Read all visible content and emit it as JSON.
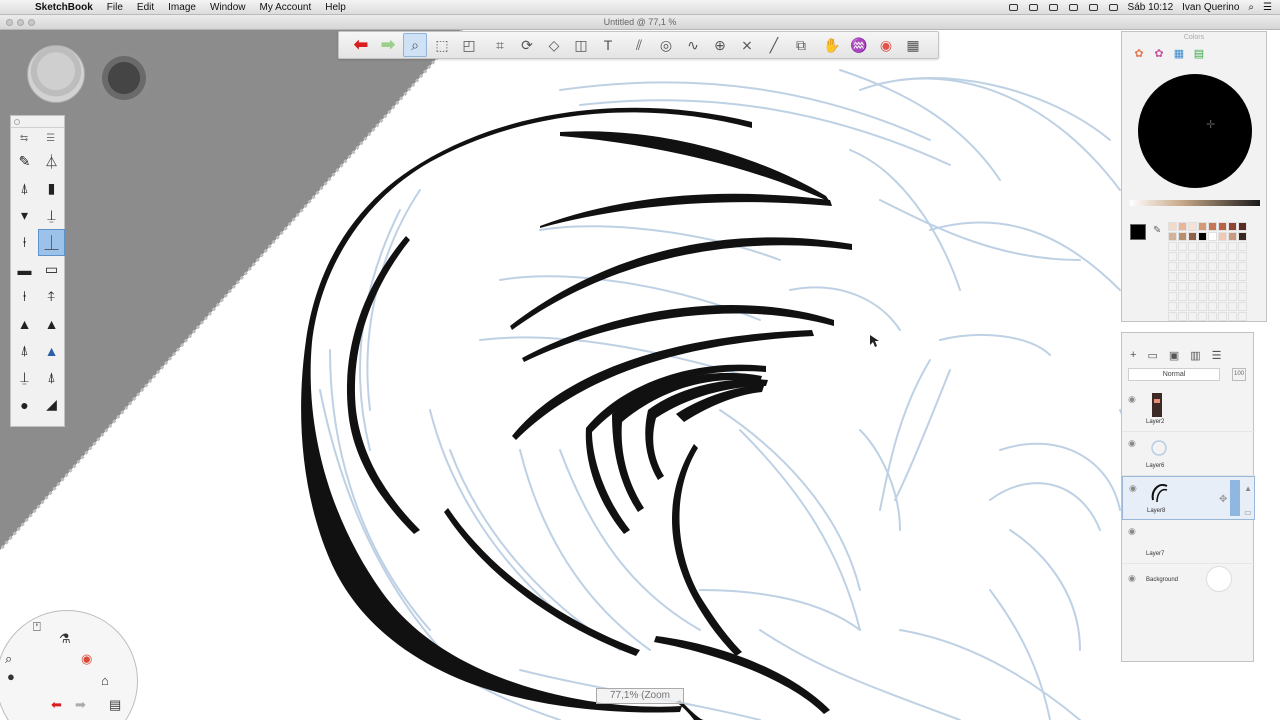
{
  "menubar": {
    "apple_icon": "apple-icon",
    "app_name": "SketchBook",
    "menus": [
      "File",
      "Edit",
      "Image",
      "Window",
      "My Account",
      "Help"
    ],
    "clock": "Sáb 10:12",
    "user": "Ivan Querino"
  },
  "window": {
    "title": "Untitled @ 77,1 %"
  },
  "toolbar": {
    "tools": [
      {
        "name": "undo",
        "glyph": "⬅"
      },
      {
        "name": "redo",
        "glyph": "➡"
      },
      {
        "name": "zoom",
        "glyph": "🔍"
      },
      {
        "name": "select",
        "glyph": "⬚"
      },
      {
        "name": "lasso-select",
        "glyph": "⬚"
      },
      {
        "name": "crop",
        "glyph": "⌗"
      },
      {
        "name": "rotate",
        "glyph": "⟳"
      },
      {
        "name": "transform",
        "glyph": "◇"
      },
      {
        "name": "shape",
        "glyph": "◫"
      },
      {
        "name": "text",
        "glyph": "T"
      },
      {
        "name": "ruler",
        "glyph": "📏"
      },
      {
        "name": "ellipse",
        "glyph": "◎"
      },
      {
        "name": "french-curve",
        "glyph": "∿"
      },
      {
        "name": "perspective",
        "glyph": "⊕"
      },
      {
        "name": "symmetry",
        "glyph": "⨯"
      },
      {
        "name": "line",
        "glyph": "╱"
      },
      {
        "name": "copy-paste",
        "glyph": "⧉"
      },
      {
        "name": "brush-palette",
        "glyph": "✋"
      },
      {
        "name": "brush-properties",
        "glyph": "♒"
      },
      {
        "name": "color-editor",
        "glyph": "◉"
      },
      {
        "name": "layer-editor",
        "glyph": "▦"
      }
    ],
    "active_tool": "zoom"
  },
  "brush_palette": {
    "brushes": [
      "pencil-brush",
      "technical-pen-brush",
      "airbrush",
      "marker-brush",
      "ballpoint-brush",
      "felt-pen-brush",
      "ink-pen-brush",
      "chisel-brush",
      "fill-brush",
      "eraser-brush",
      "smear-brush",
      "blur-brush",
      "sharpen-brush",
      "dodge-brush",
      "burn-brush",
      "flood-brush",
      "paint-brush",
      "textured-brush",
      "stamp-brush",
      "hard-eraser-brush"
    ],
    "active_index": 7
  },
  "zoom_indicator": "77,1% (Zoom",
  "colors_panel": {
    "title": "Colors",
    "current_color": "#000000",
    "swatches": [
      "#f4d9c6",
      "#e9b699",
      "#f7e3d3",
      "#d49a78",
      "#c47753",
      "#b96445",
      "#8f4533",
      "#5a2b22",
      "#d3b49b",
      "#b98e6f",
      "#8e6249",
      "#000000",
      "#ffffff",
      "#f0c8b4",
      "#c99a80",
      "#3a2620"
    ]
  },
  "layers_panel": {
    "blend_mode": "Normal",
    "opacity": "100",
    "layers": [
      {
        "name": "Layer2",
        "active": false
      },
      {
        "name": "Layer6",
        "active": false
      },
      {
        "name": "Layer8",
        "active": true
      },
      {
        "name": "Layer7",
        "active": false
      }
    ],
    "background": "Background"
  }
}
